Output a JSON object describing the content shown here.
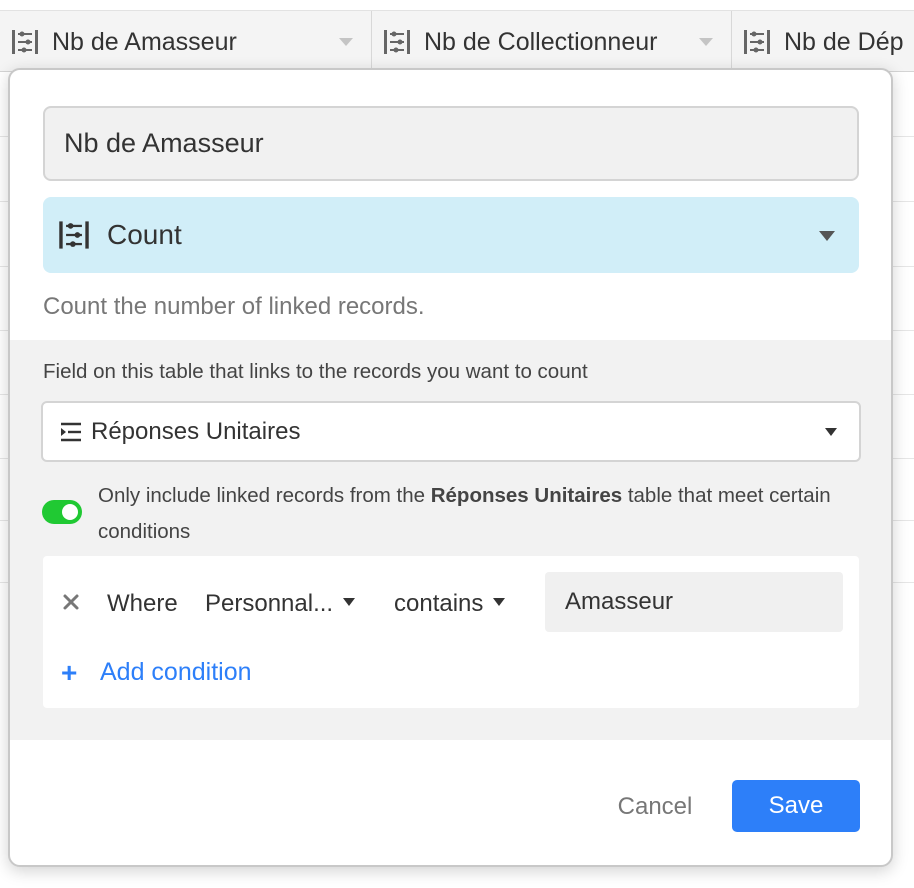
{
  "grid": {
    "columns": [
      {
        "label": "Nb de Amasseur",
        "icon": "count-field-icon"
      },
      {
        "label": "Nb de Collectionneur",
        "icon": "count-field-icon"
      },
      {
        "label": "Nb de Dép",
        "icon": "count-field-icon"
      }
    ]
  },
  "dialog": {
    "field_name": "Nb de Amasseur",
    "field_type": {
      "label": "Count",
      "icon": "count-field-icon",
      "background": "#d1eef8"
    },
    "description": "Count the number of linked records.",
    "link_prompt": "Field on this table that links to the records you want to count",
    "linked_field": {
      "label": "Réponses Unitaires",
      "icon": "linked-record-icon"
    },
    "filter_toggle": {
      "on": true,
      "color": "#20c933",
      "text_before": "Only include linked records from the ",
      "table_name": "Réponses Unitaires",
      "text_after": " table that meet certain conditions"
    },
    "condition": {
      "where_label": "Where",
      "field": "Personnal...",
      "operator": "contains",
      "value": "Amasseur"
    },
    "add_condition_label": "Add condition",
    "add_condition_symbol": "+",
    "cancel_label": "Cancel",
    "save_label": "Save",
    "accent_color": "#2d7ff9"
  }
}
